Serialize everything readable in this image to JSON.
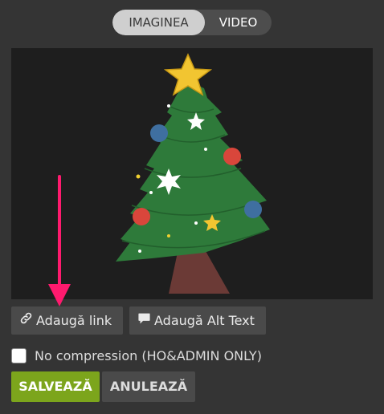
{
  "toggle": {
    "image_label": "IMAGINEA",
    "video_label": "VIDEO"
  },
  "preview": {
    "description_icon": "christmas-tree-image"
  },
  "buttons": {
    "add_link": "Adaugă link",
    "add_alt_text": "Adaugă Alt Text"
  },
  "checkbox": {
    "label": "No compression (HO&ADMIN ONLY)",
    "checked": false
  },
  "actions": {
    "save": "SALVEAZĂ",
    "cancel": "ANULEAZĂ"
  },
  "colors": {
    "accent_green": "#7ca51c",
    "arrow_pink": "#ff1a6e",
    "background": "#343434",
    "preview_bg": "#1e1e1e"
  }
}
